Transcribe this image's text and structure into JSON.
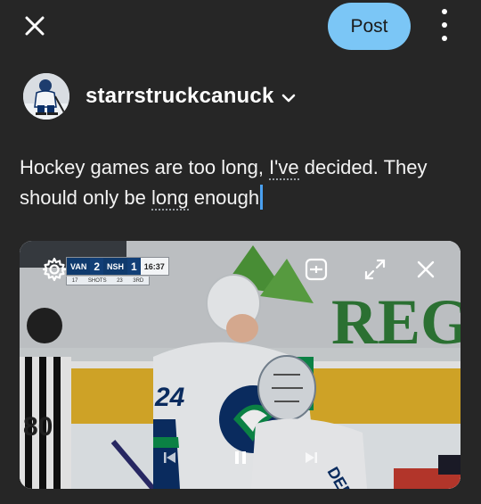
{
  "topbar": {
    "close_icon": "close-icon",
    "post_label": "Post",
    "more_icon": "more-vertical-icon"
  },
  "account": {
    "username": "starrstruckcanuck",
    "chevron_icon": "chevron-down-icon"
  },
  "post": {
    "segments": [
      {
        "text": "Hockey games are too long, ",
        "spell": false
      },
      {
        "text": "I've",
        "spell": true
      },
      {
        "text": " decided. They should only be ",
        "spell": false
      },
      {
        "text": "long",
        "spell": true
      },
      {
        "text": " enough",
        "spell": false
      }
    ]
  },
  "video": {
    "scorebug": {
      "away_team": "VAN",
      "away_score": "2",
      "home_team": "NSH",
      "home_score": "1",
      "clock": "16:37",
      "shots_away": "17",
      "shots_label": "SHOTS",
      "shots_home": "23",
      "period": "3RD"
    },
    "arena_sign": "REG",
    "jersey_number": "24",
    "referee_number": "80",
    "goalie_name": "DEMKO",
    "colors": {
      "canucks_blue": "#0b2f67",
      "canucks_green": "#0c8c4a",
      "ice": "#e8ecef",
      "board_yellow": "#e7b12a"
    }
  }
}
